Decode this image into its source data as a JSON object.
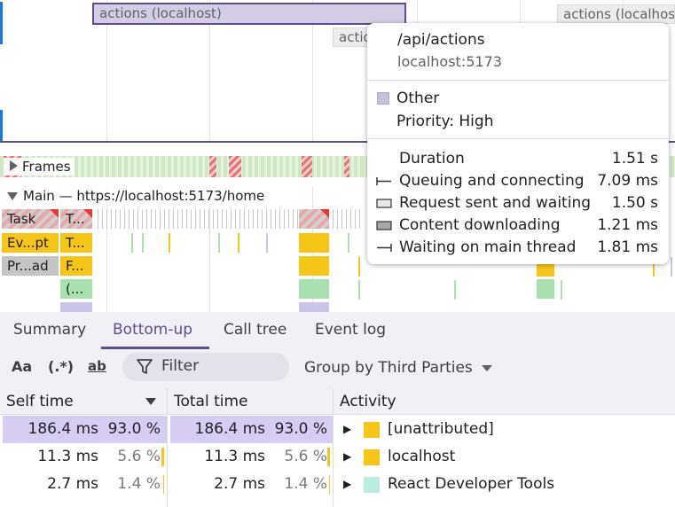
{
  "network": {
    "selected_request": "actions (localhost)",
    "request_2": "actions (localhost)",
    "request_3": "actio"
  },
  "tracks": {
    "frames_label": "Frames",
    "main_label": "Main — https://localhost:5173/home",
    "flame": {
      "task_1": "Task",
      "task_2": "T...",
      "event_1": "Ev...pt",
      "event_2": "T...",
      "parse_1": "Pr...ad",
      "parse_2": "F...",
      "call_1": "(..."
    }
  },
  "tooltip": {
    "url": "/api/actions",
    "host": "localhost:5173",
    "category": "Other",
    "category_color": "#c7bfd8",
    "priority": "Priority: High",
    "timings": [
      {
        "label": "Duration",
        "value": "1.51 s",
        "icon": ""
      },
      {
        "label": "Queuing and connecting",
        "value": "7.09 ms",
        "icon": "whisker-left-icon"
      },
      {
        "label": "Request sent and waiting",
        "value": "1.50 s",
        "icon": "light-box-icon"
      },
      {
        "label": "Content downloading",
        "value": "1.21 ms",
        "icon": "dark-box-icon"
      },
      {
        "label": "Waiting on main thread",
        "value": "1.81 ms",
        "icon": "whisker-right-icon"
      }
    ]
  },
  "panel": {
    "tabs": [
      "Summary",
      "Bottom-up",
      "Call tree",
      "Event log"
    ],
    "active_tab": "Bottom-up",
    "toolbar": {
      "match_case": "Aa",
      "regex": "(.*)",
      "whole_word": "ab",
      "filter_placeholder": "Filter",
      "group_by": "Group by Third Parties"
    },
    "columns": {
      "self": "Self time",
      "total": "Total time",
      "activity": "Activity"
    },
    "rows": [
      {
        "self_time": "186.4 ms",
        "self_pct": "93.0 %",
        "total_time": "186.4 ms",
        "total_pct": "93.0 %",
        "activity": "[unattributed]",
        "color": "#f5c518"
      },
      {
        "self_time": "11.3 ms",
        "self_pct": "5.6 %",
        "total_time": "11.3 ms",
        "total_pct": "5.6 %",
        "activity": "localhost",
        "color": "#f5c518"
      },
      {
        "self_time": "2.7 ms",
        "self_pct": "1.4 %",
        "total_time": "2.7 ms",
        "total_pct": "1.4 %",
        "activity": "React Developer Tools",
        "color": "#b8ede0"
      }
    ]
  }
}
